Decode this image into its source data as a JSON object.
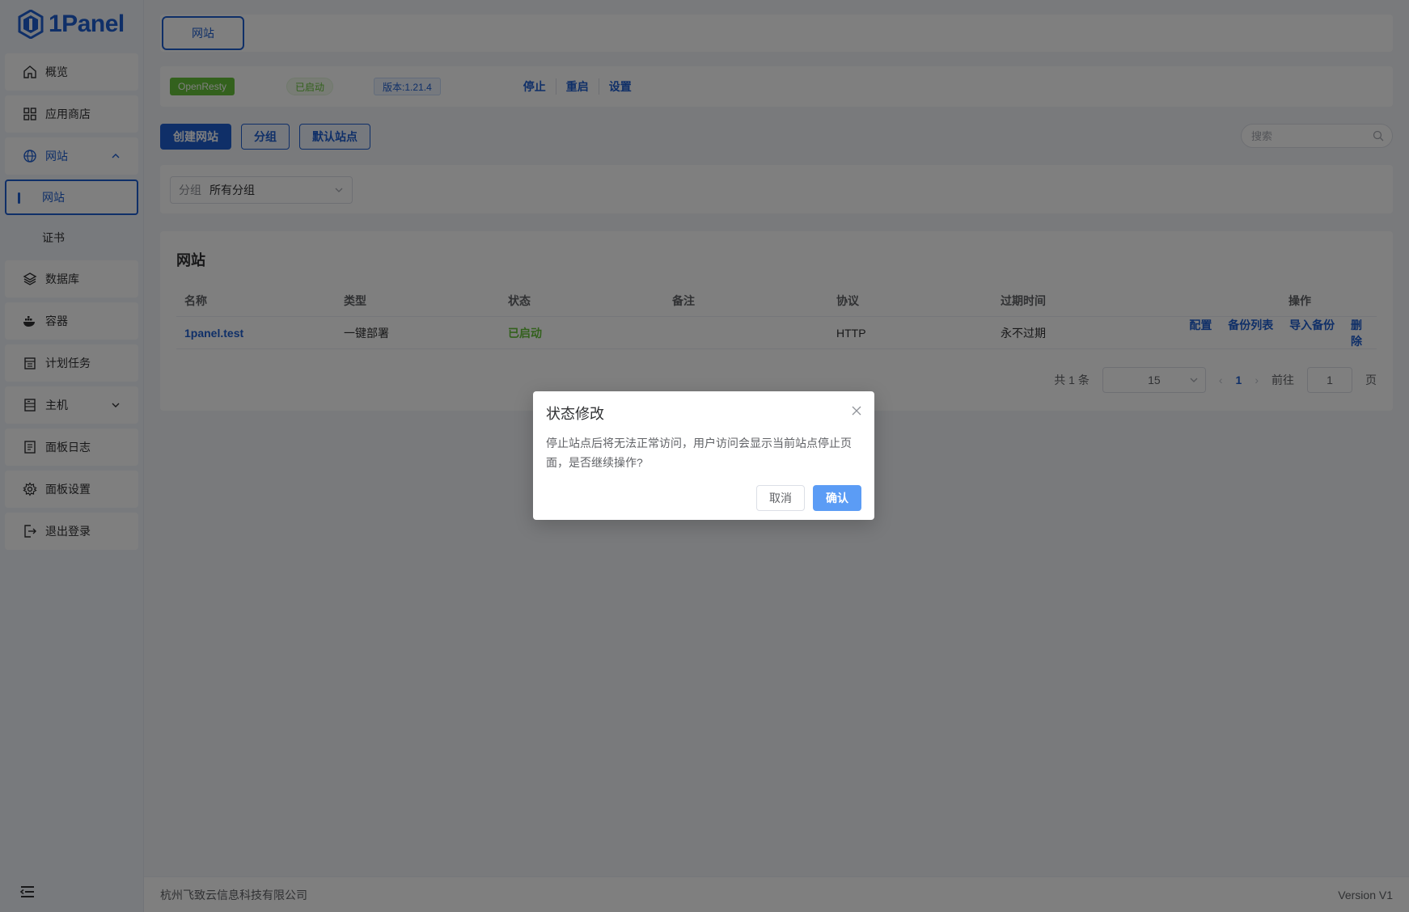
{
  "app": {
    "logo_text": "1Panel",
    "brand_color": "#1f5fd1"
  },
  "sidebar": {
    "items": [
      {
        "label": "概览",
        "icon": "home-icon"
      },
      {
        "label": "应用商店",
        "icon": "grid-icon"
      },
      {
        "label": "网站",
        "icon": "globe-icon",
        "expanded": true
      },
      {
        "label": "网站",
        "sub": true,
        "active": true
      },
      {
        "label": "证书",
        "sub": true
      },
      {
        "label": "数据库",
        "icon": "layers-icon"
      },
      {
        "label": "容器",
        "icon": "docker-icon"
      },
      {
        "label": "计划任务",
        "icon": "calendar-icon"
      },
      {
        "label": "主机",
        "icon": "server-icon"
      },
      {
        "label": "面板日志",
        "icon": "log-icon"
      },
      {
        "label": "面板设置",
        "icon": "gear-icon"
      },
      {
        "label": "退出登录",
        "icon": "logout-icon"
      }
    ]
  },
  "tabs": {
    "active": "网站"
  },
  "status_bar": {
    "app_name": "OpenResty",
    "state": "已启动",
    "version": "版本:1.21.4",
    "actions": [
      "停止",
      "重启",
      "设置"
    ]
  },
  "toolbar": {
    "create": "创建网站",
    "group": "分组",
    "default_site": "默认站点",
    "search_placeholder": "搜索"
  },
  "filter": {
    "prefix": "分组",
    "value": "所有分组"
  },
  "table": {
    "title": "网站",
    "columns": [
      "名称",
      "类型",
      "状态",
      "备注",
      "协议",
      "过期时间",
      "操作"
    ],
    "rows": [
      {
        "name": "1panel.test",
        "type": "一键部署",
        "status": "已启动",
        "remark": "",
        "protocol": "HTTP",
        "expire": "永不过期",
        "ops": [
          "配置",
          "备份列表",
          "导入备份",
          "删除"
        ]
      }
    ]
  },
  "pagination": {
    "total": "共 1 条",
    "page_size": "15",
    "current": "1",
    "goto_label": "前往",
    "goto_value": "1",
    "page_suffix": "页"
  },
  "footer": {
    "company": "杭州飞致云信息科技有限公司",
    "version": "Version V1"
  },
  "dialog": {
    "title": "状态修改",
    "message": "停止站点后将无法正常访问，用户访问会显示当前站点停止页面，是否继续操作?",
    "cancel": "取消",
    "confirm": "确认"
  }
}
